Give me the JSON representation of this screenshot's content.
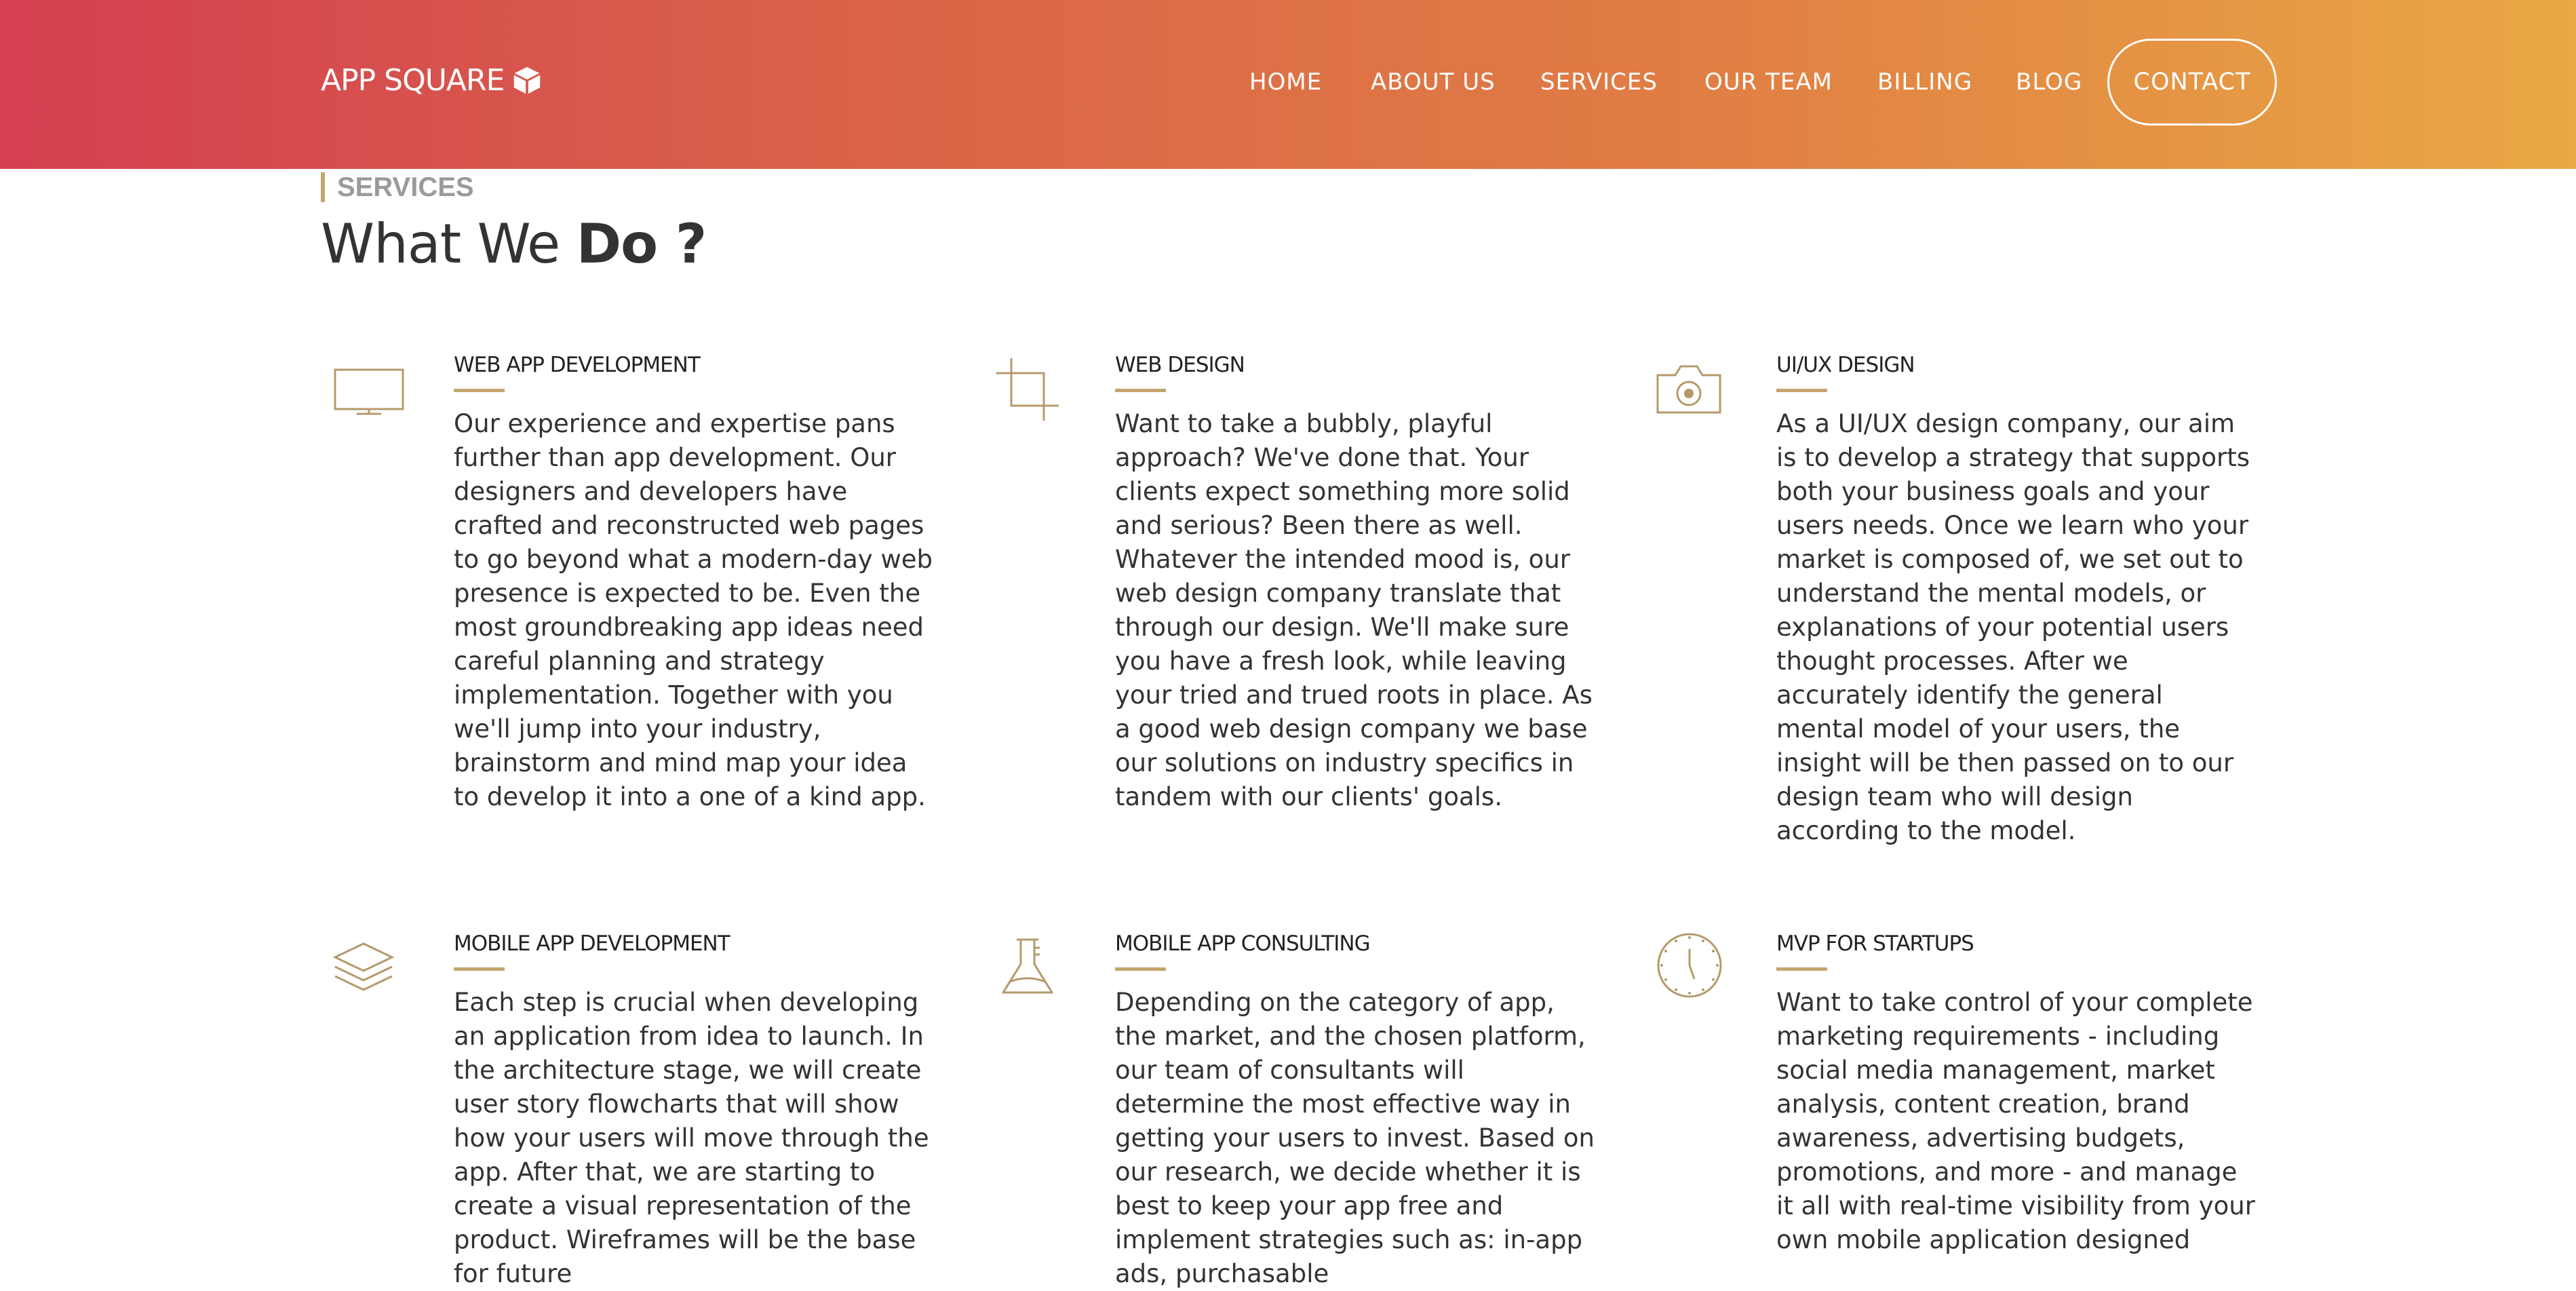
{
  "brand": {
    "name": "APP SQUARE",
    "icon": "cube-icon"
  },
  "nav": {
    "items": [
      "HOME",
      "ABOUT US",
      "SERVICES",
      "OUR TEAM",
      "BILLING",
      "BLOG"
    ],
    "contact_label": "CONTACT"
  },
  "colors": {
    "gradient_start": "#d43f51",
    "gradient_end": "#e9a844",
    "accent": "#c4a56f"
  },
  "section": {
    "label": "SERVICES",
    "title_light": "What We",
    "title_bold": "Do ?"
  },
  "services": [
    {
      "icon": "monitor-icon",
      "title": "WEB APP DEVELOPMENT",
      "body": "Our experience and expertise pans further than app development. Our designers and developers have crafted and reconstructed web pages to go beyond what a modern-day web presence is expected to be. Even the most groundbreaking app ideas need careful planning and strategy implementation. Together with you we'll jump into your industry, brainstorm and mind map your idea to develop it into a one of a kind app."
    },
    {
      "icon": "crop-icon",
      "title": "WEB DESIGN",
      "body": "Want to take a bubbly, playful approach? We've done that. Your clients expect something more solid and serious? Been there as well. Whatever the intended mood is, our web design company translate that through our design. We'll make sure you have a fresh look, while leaving your tried and trued roots in place. As a good web design company we base our solutions on industry specifics in tandem with our clients' goals."
    },
    {
      "icon": "camera-icon",
      "title": "UI/UX DESIGN",
      "body": "As a UI/UX design company, our aim is to develop a strategy that supports both your business goals and your users needs. Once we learn who your market is composed of, we set out to understand the mental models, or explanations of your potential users thought processes. After we accurately identify the general mental model of your users, the insight will be then passed on to our design team who will design according to the model."
    },
    {
      "icon": "layers-icon",
      "title": "MOBILE APP DEVELOPMENT",
      "body": "Each step is crucial when developing an application from idea to launch. In the architecture stage, we will create user story flowcharts that will show how your users will move through the app. After that, we are starting to create a visual representation of the product. Wireframes will be the base for future"
    },
    {
      "icon": "flask-icon",
      "title": "MOBILE APP CONSULTING",
      "body": "Depending on the category of app, the market, and the chosen platform, our team of consultants will determine the most effective way in getting your users to invest. Based on our research, we decide whether it is best to keep your app free and implement strategies such as: in-app ads, purchasable"
    },
    {
      "icon": "clock-icon",
      "title": "MVP FOR STARTUPS",
      "body": "Want to take control of your complete marketing requirements - including social media management, market analysis, content creation, brand awareness, advertising budgets, promotions, and more - and manage it all with real-time visibility from your own mobile application designed"
    }
  ]
}
